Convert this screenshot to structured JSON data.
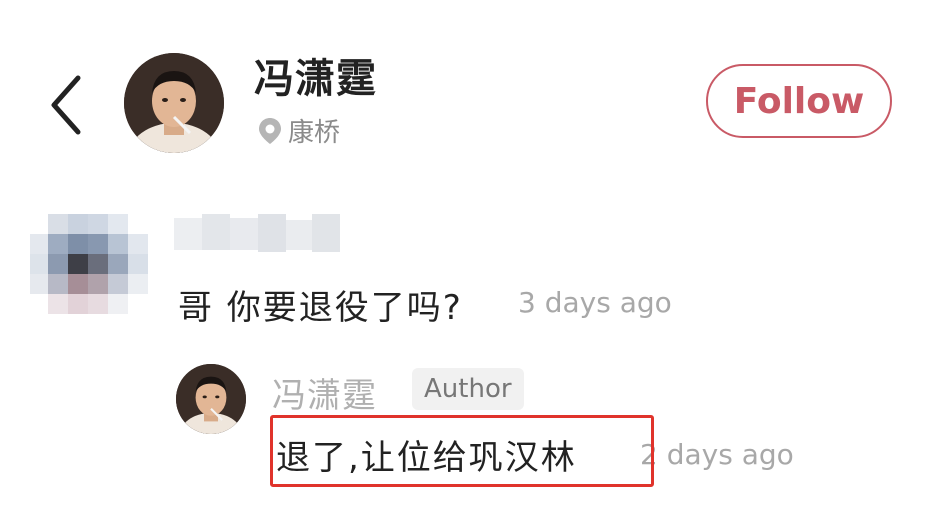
{
  "header": {
    "back_icon": "chevron-left-icon",
    "author_name": "冯潇霆",
    "location_icon": "location-pin-icon",
    "location": "康桥",
    "follow_label": "Follow",
    "follow_color": "#c95a66"
  },
  "comment": {
    "text": "哥 你要退役了吗?",
    "time": "3 days ago"
  },
  "reply": {
    "name": "冯潇霆",
    "badge": "Author",
    "text": "退了,让位给巩汉林",
    "time": "2 days ago",
    "highlight_color": "#e0332b"
  }
}
